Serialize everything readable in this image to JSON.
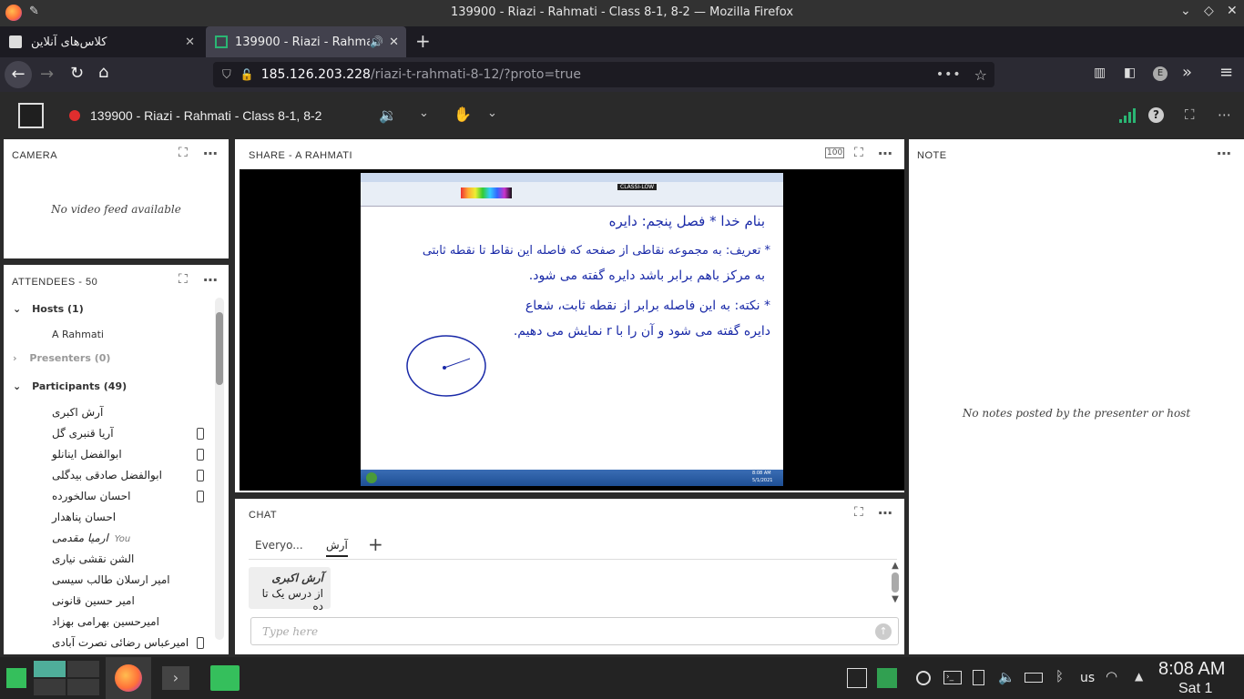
{
  "window": {
    "title": "139900 - Riazi - Rahmati - Class 8-1, 8-2 — Mozilla Firefox"
  },
  "tabs": [
    {
      "label": "کلاس‌های آنلاین"
    },
    {
      "label": "139900 - Riazi - Rahmat"
    }
  ],
  "url": {
    "host": "185.126.203.228",
    "path": "/riazi-t-rahmati-8-12/?proto=true"
  },
  "app": {
    "class_title": "139900 - Riazi - Rahmati - Class 8-1, 8-2"
  },
  "camera": {
    "label": "CAMERA",
    "empty": "No video feed available"
  },
  "attendees": {
    "label": "ATTENDEES - 50",
    "hosts_label": "Hosts (1)",
    "host_name": "A Rahmati",
    "presenters_label": "Presenters (0)",
    "participants_label": "Participants (49)",
    "participants": [
      "آرش اکبری",
      "آریا قنبری گل",
      "ابوالفضل اینانلو",
      "ابوالفضل صادقی بیدگلی",
      "احسان سالخورده",
      "احسان پناهدار",
      "ارمیا مقدمی",
      "الشن نقشی نیاری",
      "امیر ارسلان طالب سیسی",
      "امیر حسین قانونی",
      "امیرحسین بهرامی بهزاد",
      "امیرعباس رضائی نصرت آبادی"
    ],
    "you_label": "You"
  },
  "share": {
    "label": "SHARE - A RAHMATI"
  },
  "slide": {
    "line1": "بنام خدا * فصل پنجم: دایره",
    "line2": "* تعریف: به مجموعه نقاطی از صفحه که فاصله این نقاط تا نقطه ثابتی",
    "line3": "به مرکز باهم برابر باشد دایره گفته می شود.",
    "line4": "* نکته: به این فاصله برابر از نقطه ثابت، شعاع",
    "line5": "دایره گفته می شود و آن را با r نمایش می دهیم.",
    "toolbar_label": "CLASSI-LOW",
    "time": "8:08 AM",
    "date": "5/1/2021"
  },
  "note": {
    "label": "NOTE",
    "empty": "No notes posted by the presenter or host"
  },
  "chat": {
    "label": "CHAT",
    "tab_everyone": "Everyo...",
    "tab_user": "آرش",
    "message_author": "آرش اکبری",
    "message_text": "از درس یک تا ده",
    "input_placeholder": "Type here"
  },
  "taskbar": {
    "lang": "us",
    "time": "8:08 AM",
    "date": "Sat 1"
  },
  "colors": {
    "live_dot": "#e02e2e",
    "accent": "#2ab673",
    "ink": "#1a2aa8"
  }
}
